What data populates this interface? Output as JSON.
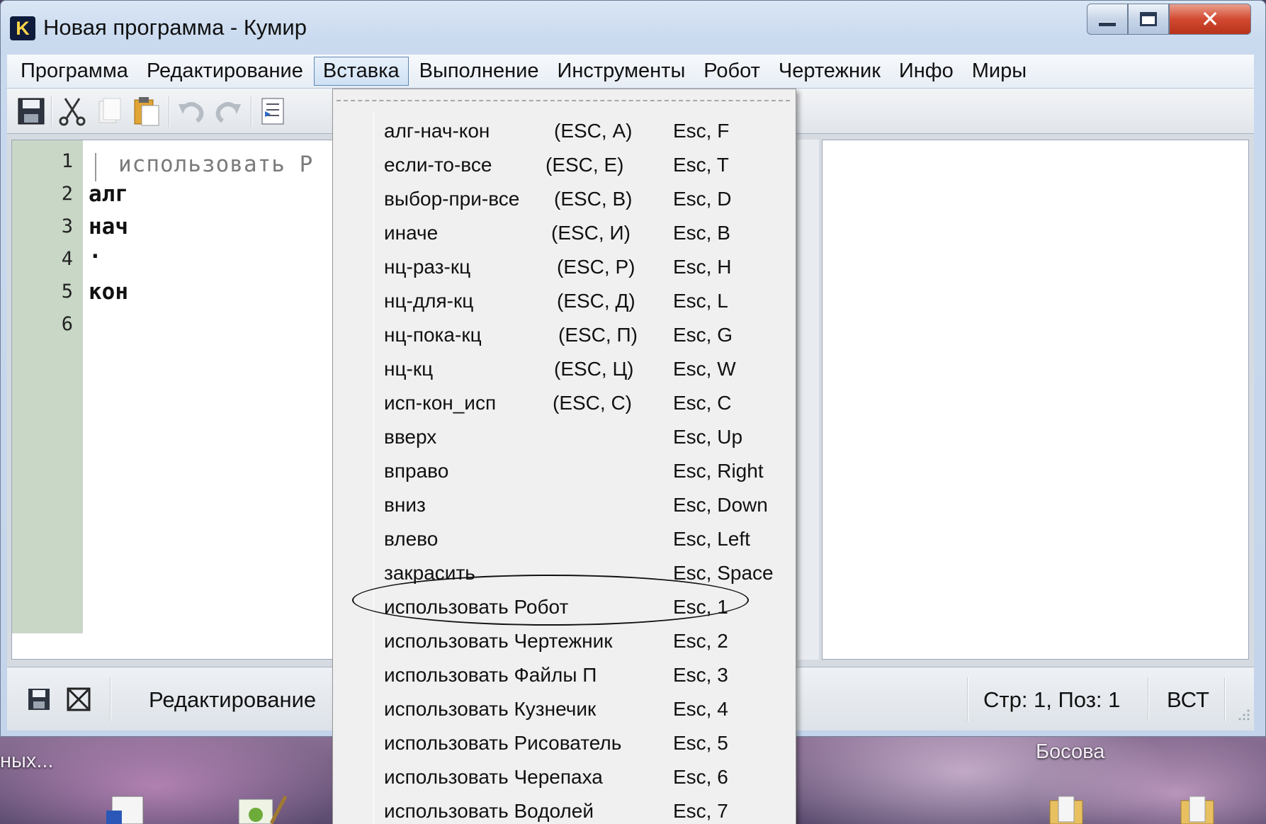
{
  "window": {
    "title": "Новая программа - Кумир",
    "logo_letter": "K"
  },
  "menubar": {
    "items": [
      "Программа",
      "Редактирование",
      "Вставка",
      "Выполнение",
      "Инструменты",
      "Робот",
      "Чертежник",
      "Инфо",
      "Миры"
    ],
    "active_index": 2
  },
  "toolbar": {
    "icons": [
      "save-icon",
      "cut-icon",
      "copy-icon",
      "paste-icon",
      "undo-icon",
      "redo-icon",
      "insert-icon"
    ]
  },
  "editor": {
    "line_numbers": [
      "1",
      "2",
      "3",
      "4",
      "5",
      "6"
    ],
    "lines": [
      "использовать Р",
      "алг",
      "нач",
      "·",
      "кон",
      ""
    ]
  },
  "statusbar": {
    "mode": "Редактирование",
    "position": "Стр: 1, Поз: 1",
    "insert_mode": "ВСТ"
  },
  "insert_menu": {
    "items": [
      {
        "label": "алг-нач-кон",
        "alt": "(ESC, А)",
        "key": "Esc, F"
      },
      {
        "label": "если-то-все",
        "alt": "(ESC, Е)",
        "key": "Esc, T"
      },
      {
        "label": "выбор-при-все",
        "alt": "(ESC, В)",
        "key": "Esc, D"
      },
      {
        "label": "иначе",
        "alt": "(ESC, И)",
        "key": "Esc, B"
      },
      {
        "label": "нц-раз-кц",
        "alt": "(ESC, Р)",
        "key": "Esc, H"
      },
      {
        "label": "нц-для-кц",
        "alt": "(ESC, Д)",
        "key": "Esc, L"
      },
      {
        "label": "нц-пока-кц",
        "alt": "(ESC, П)",
        "key": "Esc, G"
      },
      {
        "label": "нц-кц",
        "alt": "(ESC, Ц)",
        "key": "Esc, W"
      },
      {
        "label": "исп-кон_исп",
        "alt": "(ESC, С)",
        "key": "Esc, C"
      },
      {
        "label": "вверх",
        "alt": "",
        "key": "Esc, Up"
      },
      {
        "label": "вправо",
        "alt": "",
        "key": "Esc, Right"
      },
      {
        "label": "вниз",
        "alt": "",
        "key": "Esc, Down"
      },
      {
        "label": "влево",
        "alt": "",
        "key": "Esc, Left"
      },
      {
        "label": "закрасить",
        "alt": "",
        "key": "Esc, Space"
      },
      {
        "label": "использовать Робот",
        "alt": "",
        "key": "Esc, 1"
      },
      {
        "label": "использовать Чертежник",
        "alt": "",
        "key": "Esc, 2"
      },
      {
        "label": "использовать Файлы П",
        "alt": "",
        "key": "Esc, 3"
      },
      {
        "label": "использовать Кузнечик",
        "alt": "",
        "key": "Esc, 4"
      },
      {
        "label": "использовать Рисователь",
        "alt": "",
        "key": "Esc, 5"
      },
      {
        "label": "использовать Черепаха",
        "alt": "",
        "key": "Esc, 6"
      },
      {
        "label": "использовать Водолей",
        "alt": "",
        "key": "Esc, 7"
      }
    ],
    "highlighted_index": 14
  },
  "desktop": {
    "left_label": "ных...",
    "right_label": "Босова"
  }
}
